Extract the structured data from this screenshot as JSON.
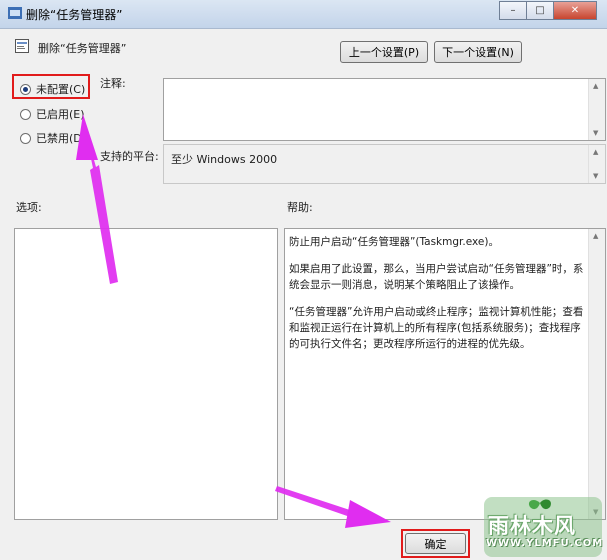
{
  "window": {
    "title": "删除“任务管理器”",
    "caption": {
      "minimize": "–",
      "maximize": "□",
      "close": "✕"
    }
  },
  "header": {
    "title": "删除“任务管理器”",
    "prev_label": "上一个设置(P)",
    "next_label": "下一个设置(N)"
  },
  "state": {
    "options": [
      {
        "label": "未配置(C)",
        "selected": true
      },
      {
        "label": "已启用(E)",
        "selected": false
      },
      {
        "label": "已禁用(D)",
        "selected": false
      }
    ]
  },
  "comment": {
    "label": "注释:",
    "value": ""
  },
  "platform": {
    "label": "支持的平台:",
    "value": "至少 Windows 2000"
  },
  "options_panel": {
    "label": "选项:"
  },
  "help_panel": {
    "label": "帮助:",
    "paragraphs": [
      "防止用户启动“任务管理器”(Taskmgr.exe)。",
      "如果启用了此设置，那么，当用户尝试启动“任务管理器”时，系统会显示一则消息，说明某个策略阻止了该操作。",
      "“任务管理器”允许用户启动或终止程序；监视计算机性能；查看和监视正运行在计算机上的所有程序(包括系统服务)；查找程序的可执行文件名；更改程序所运行的进程的优先级。"
    ]
  },
  "footer": {
    "ok_label": "确定"
  },
  "watermark": {
    "title": "雨林木风",
    "url": "WWW.YLMFU.COM"
  },
  "colors": {
    "highlight": "#e11b1b",
    "arrow": "#e02df0"
  }
}
